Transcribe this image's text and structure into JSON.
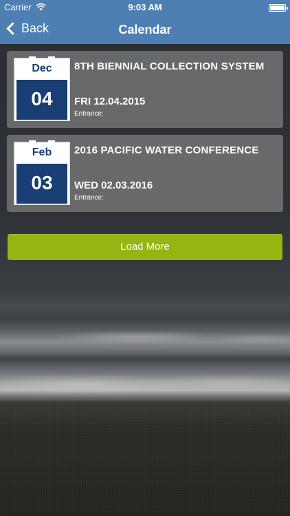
{
  "status_bar": {
    "carrier": "Carrier",
    "time": "9:03 AM",
    "wifi_icon": "wifi-icon",
    "battery_icon": "battery-icon"
  },
  "nav": {
    "back_label": "Back",
    "title": "Calendar"
  },
  "events": [
    {
      "month": "Dec",
      "day": "04",
      "title": "8TH BIENNIAL COLLECTION SYSTEM",
      "date": "FRI 12.04.2015",
      "entrance": "Entrance:"
    },
    {
      "month": "Feb",
      "day": "03",
      "title": "2016 PACIFIC WATER CONFERENCE",
      "date": "WED 02.03.2016",
      "entrance": "Entrance:"
    }
  ],
  "load_more_label": "Load More",
  "colors": {
    "nav_bar": "#4d7fb3",
    "calendar_day": "#183e73",
    "load_more": "#95b513"
  }
}
